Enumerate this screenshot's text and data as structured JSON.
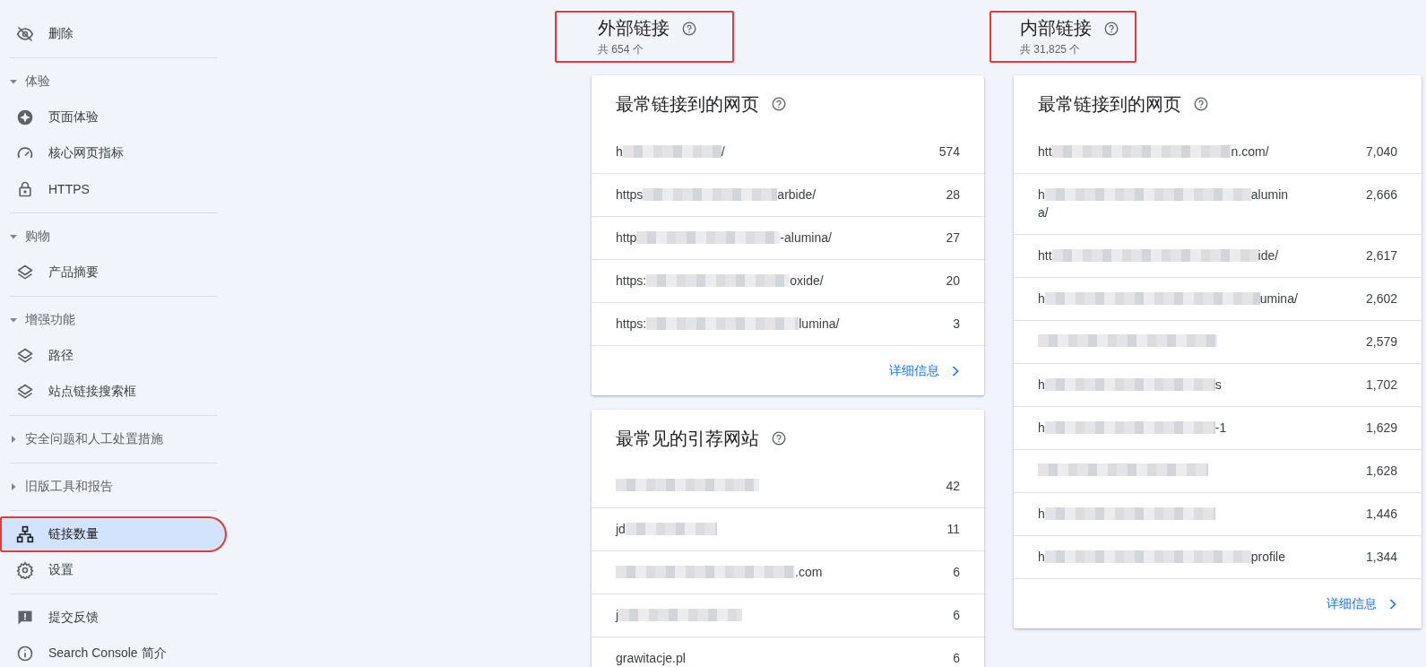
{
  "sidebar": {
    "groups": [
      {
        "items": [
          {
            "label": "删除",
            "selected": false,
            "highlighted": false
          }
        ]
      },
      {
        "title": "体验",
        "expanded": true,
        "items": [
          {
            "label": "页面体验",
            "selected": false,
            "highlighted": false
          },
          {
            "label": "核心网页指标",
            "selected": false,
            "highlighted": false
          },
          {
            "label": "HTTPS",
            "selected": false,
            "highlighted": false
          }
        ]
      },
      {
        "title": "购物",
        "expanded": true,
        "items": [
          {
            "label": "产品摘要",
            "selected": false,
            "highlighted": false
          }
        ]
      },
      {
        "title": "增强功能",
        "expanded": true,
        "items": [
          {
            "label": "路径",
            "selected": false,
            "highlighted": false
          },
          {
            "label": "站点链接搜索框",
            "selected": false,
            "highlighted": false
          }
        ]
      },
      {
        "title": "安全问题和人工处置措施",
        "expanded": false
      },
      {
        "title": "旧版工具和报告",
        "expanded": false
      },
      {
        "items": [
          {
            "label": "链接数量",
            "selected": true,
            "highlighted": true
          },
          {
            "label": "设置",
            "selected": false,
            "highlighted": false
          }
        ]
      },
      {
        "items": [
          {
            "label": "提交反馈",
            "selected": false,
            "highlighted": false
          },
          {
            "label": "Search Console 简介",
            "selected": false,
            "highlighted": false
          }
        ]
      }
    ]
  },
  "columns": [
    {
      "title": "外部链接",
      "total": "共 654 个",
      "highlighted": true,
      "cards": [
        {
          "title": "最常链接到的网页",
          "rows": [
            {
              "prefix": "h",
              "suffix": "/",
              "count": "574"
            },
            {
              "prefix": "https",
              "suffix": "arbide/",
              "count": "28"
            },
            {
              "prefix": "http",
              "suffix": "-alumina/",
              "count": "27"
            },
            {
              "prefix": "https:",
              "suffix": "oxide/",
              "count": "20"
            },
            {
              "prefix": "https:",
              "suffix": "lumina/",
              "count": "3"
            }
          ],
          "more": "详细信息"
        },
        {
          "title": "最常见的引荐网站",
          "rows": [
            {
              "count": "42"
            },
            {
              "prefix": "jd",
              "count": "11"
            },
            {
              "suffix": ".com",
              "count": "6"
            },
            {
              "prefix": "j",
              "count": "6"
            },
            {
              "prefix": "grawitacje.pl",
              "count": "6"
            }
          ]
        }
      ]
    },
    {
      "title": "内部链接",
      "total": "共 31,825 个",
      "highlighted": true,
      "cards": [
        {
          "title": "最常链接到的网页",
          "rows": [
            {
              "prefix": "htt",
              "suffix": "n.com/",
              "count": "7,040"
            },
            {
              "prefix": "h",
              "suffix": "alumin",
              "continuation": "a/",
              "count": "2,666"
            },
            {
              "prefix": "htt",
              "suffix": "ide/",
              "count": "2,617"
            },
            {
              "prefix": "h",
              "suffix": "umina/",
              "count": "2,602"
            },
            {
              "count": "2,579"
            },
            {
              "prefix": "h",
              "suffix": "s",
              "count": "1,702"
            },
            {
              "prefix": "h",
              "suffix": "-1",
              "count": "1,629"
            },
            {
              "count": "1,628"
            },
            {
              "prefix": "h",
              "count": "1,446"
            },
            {
              "prefix": "h",
              "suffix": "profile",
              "count": "1,344"
            }
          ],
          "more": "详细信息"
        }
      ]
    }
  ]
}
